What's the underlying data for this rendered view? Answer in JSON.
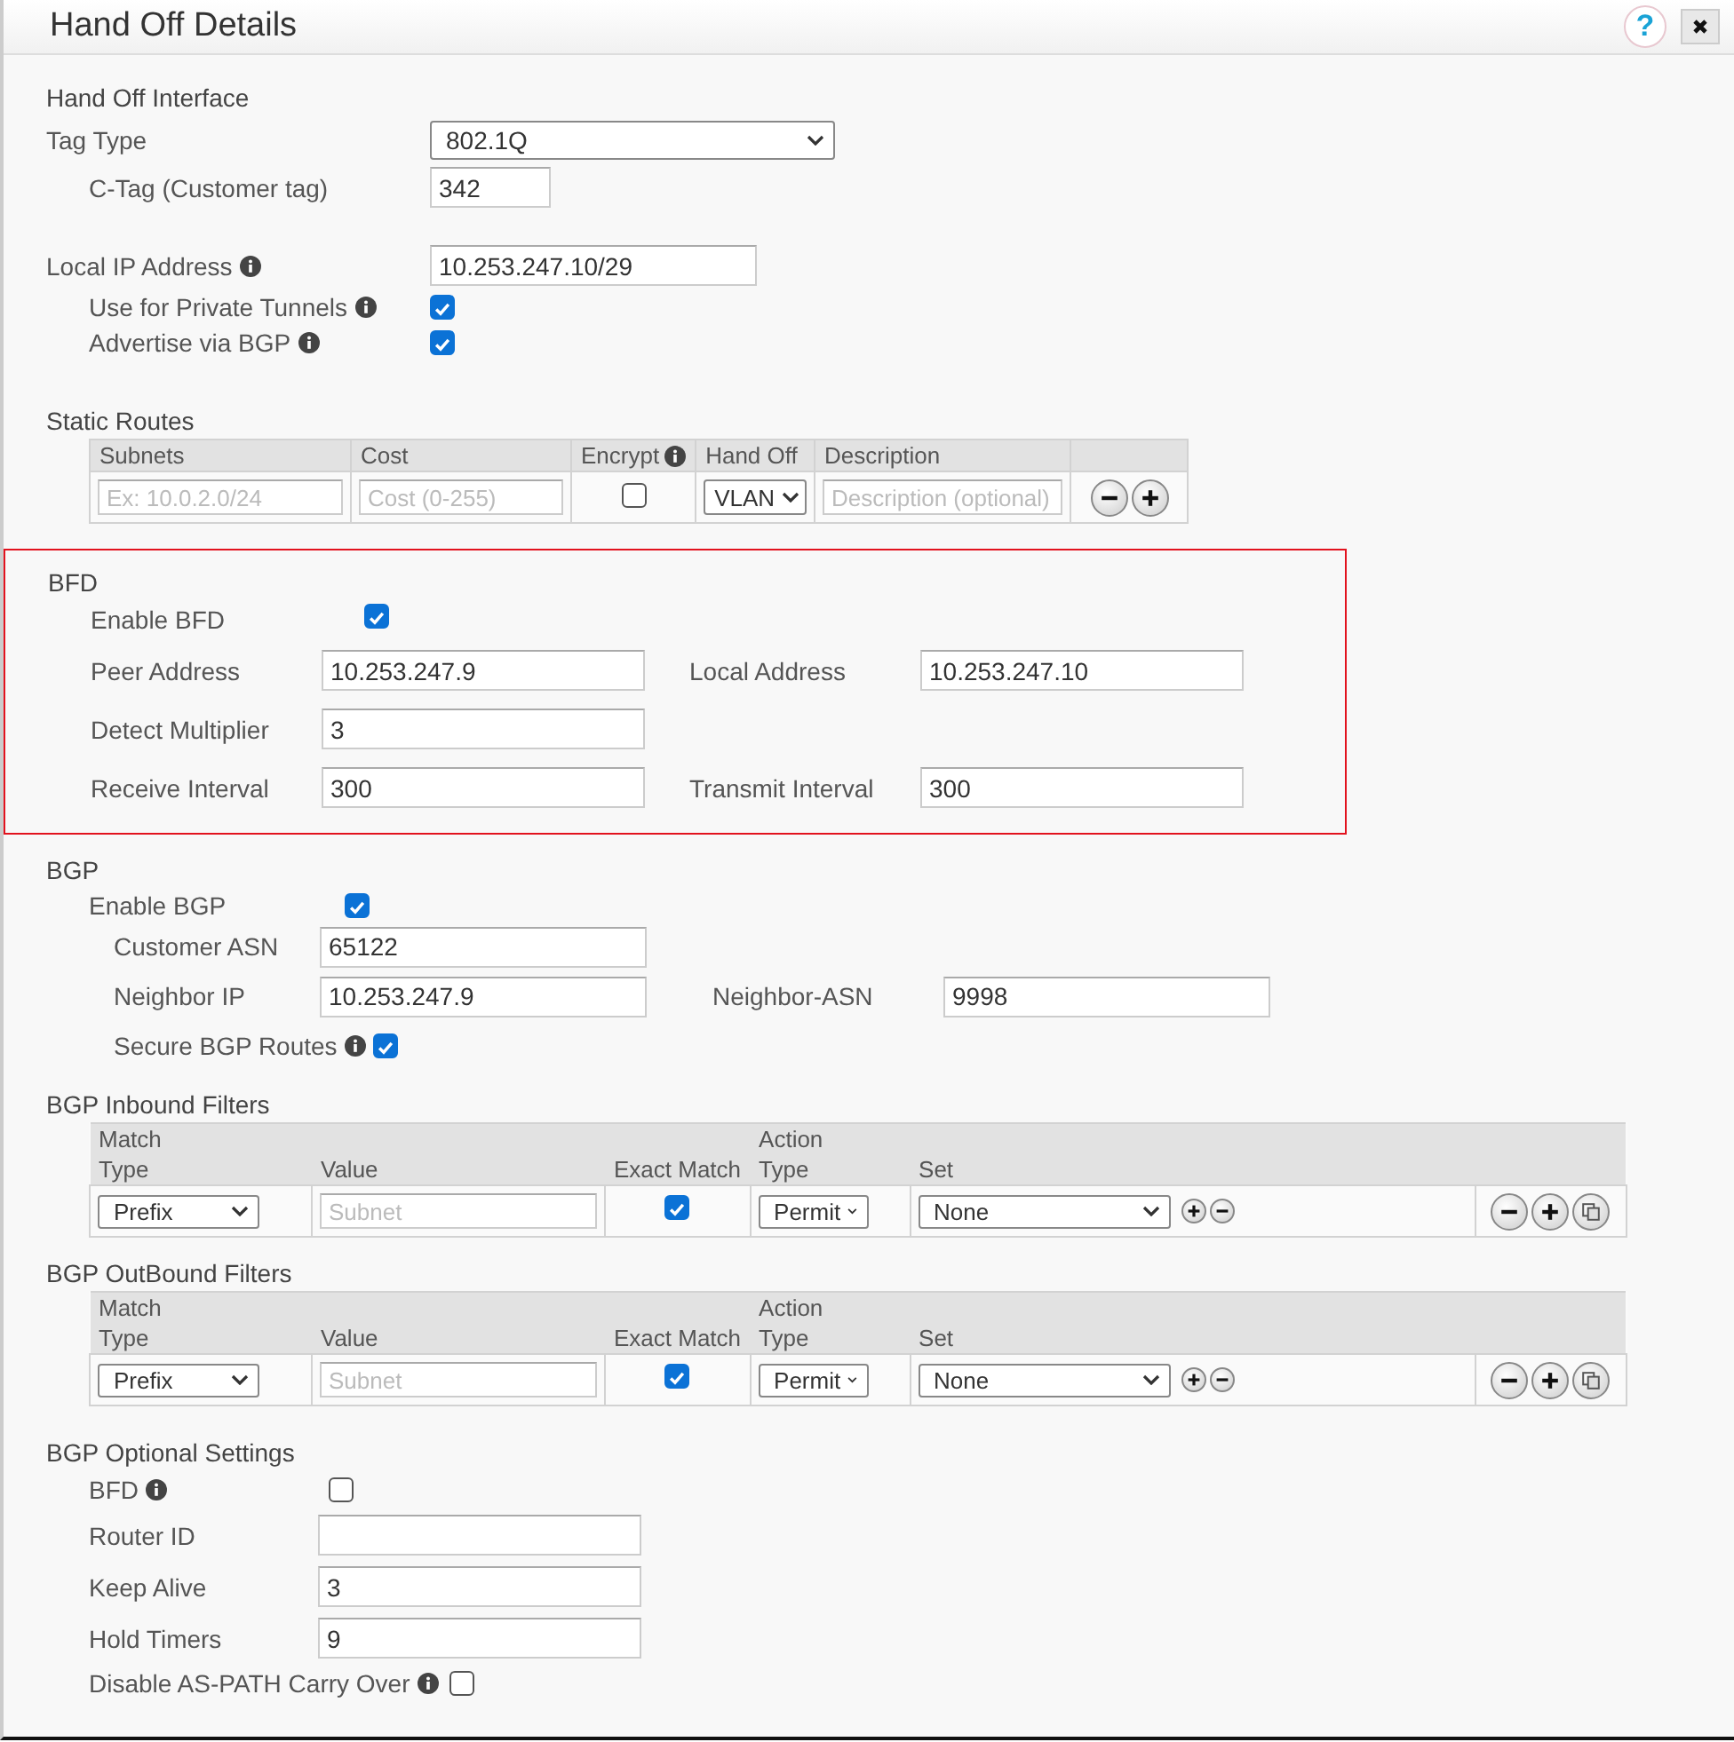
{
  "window": {
    "title": "Hand Off Details",
    "help": "?"
  },
  "hand_off_interface": {
    "title": "Hand Off Interface",
    "rows": [
      {
        "kind": "select",
        "label": "Tag Type",
        "value": "802.1Q",
        "info": false,
        "children": [
          {
            "kind": "input",
            "label": "C-Tag (Customer tag)",
            "value": "342",
            "info": false
          }
        ]
      },
      {
        "kind": "input",
        "label": "Local IP Address",
        "value": "10.253.247.10/29",
        "info": true,
        "children": [
          {
            "kind": "checkbox",
            "label": "Use for Private Tunnels",
            "checked": true,
            "info": true
          },
          {
            "kind": "checkbox",
            "label": "Advertise via BGP",
            "checked": true,
            "info": true
          }
        ]
      }
    ]
  },
  "static_routes": {
    "title": "Static Routes",
    "columns": [
      {
        "label": "Subnets",
        "info": false
      },
      {
        "label": "Cost",
        "info": false
      },
      {
        "label": "Encrypt",
        "info": true
      },
      {
        "label": "Hand Off",
        "info": false
      },
      {
        "label": "Description",
        "info": false
      }
    ],
    "rows": [
      {
        "subnets_placeholder": "Ex: 10.0.2.0/24",
        "cost_placeholder": "Cost (0-255)",
        "encrypt": false,
        "hand_off": "VLAN",
        "description_placeholder": "Description (optional)"
      }
    ]
  },
  "bfd": {
    "title": "BFD",
    "enable": {
      "label": "Enable BFD",
      "checked": true
    },
    "fields": [
      {
        "label": "Peer Address",
        "value": "10.253.247.9"
      },
      {
        "label": "Local Address",
        "value": "10.253.247.10"
      },
      {
        "label": "Detect Multiplier",
        "value": "3"
      },
      {
        "label": "Receive Interval",
        "value": "300"
      },
      {
        "label": "Transmit Interval",
        "value": "300"
      }
    ]
  },
  "bgp": {
    "title": "BGP",
    "enable": {
      "label": "Enable BGP",
      "checked": true,
      "children": [
        {
          "kind": "input",
          "label": "Customer ASN",
          "value": "65122",
          "info": false
        },
        {
          "kind": "input",
          "label": "Neighbor IP",
          "value": "10.253.247.9",
          "info": false
        },
        {
          "kind": "input",
          "label": "Neighbor-ASN",
          "value": "9998",
          "info": false
        },
        {
          "kind": "checkbox",
          "label": "Secure BGP Routes",
          "checked": true,
          "info": true
        }
      ]
    }
  },
  "filters": [
    {
      "title": "BGP Inbound Filters",
      "groups": [
        "Match",
        "Action"
      ],
      "columns": [
        "Type",
        "Value",
        "Exact Match",
        "Type",
        "Set"
      ],
      "rows": [
        {
          "match_type": "Prefix",
          "value_placeholder": "Subnet",
          "exact_match": true,
          "action_type": "Permit",
          "set": "None"
        }
      ]
    },
    {
      "title": "BGP OutBound Filters",
      "groups": [
        "Match",
        "Action"
      ],
      "columns": [
        "Type",
        "Value",
        "Exact Match",
        "Type",
        "Set"
      ],
      "rows": [
        {
          "match_type": "Prefix",
          "value_placeholder": "Subnet",
          "exact_match": true,
          "action_type": "Permit",
          "set": "None"
        }
      ]
    }
  ],
  "bgp_optional": {
    "title": "BGP Optional Settings",
    "rows": [
      {
        "kind": "checkbox",
        "label": "BFD",
        "checked": false,
        "info": true
      },
      {
        "kind": "input",
        "label": "Router ID",
        "info": false
      },
      {
        "kind": "input",
        "label": "Keep Alive",
        "value": "3",
        "info": false
      },
      {
        "kind": "input",
        "label": "Hold Timers",
        "value": "9",
        "info": false
      },
      {
        "kind": "checkbox",
        "label": "Disable AS-PATH Carry Over",
        "checked": false,
        "info": true
      }
    ]
  }
}
